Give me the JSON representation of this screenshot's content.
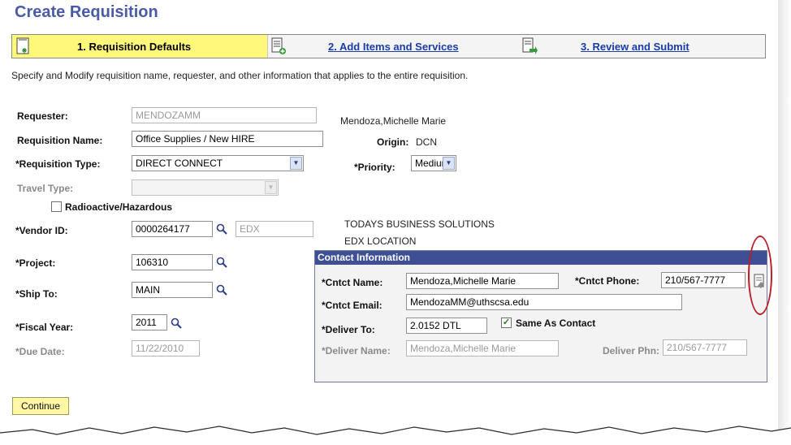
{
  "page_title": "Create Requisition",
  "steps": [
    {
      "label": "1. Requisition Defaults",
      "active": true
    },
    {
      "label": "2. Add Items and Services",
      "active": false
    },
    {
      "label": "3. Review and Submit",
      "active": false
    }
  ],
  "description": "Specify and Modify requisition name, requester, and other information that applies to the entire requisition.",
  "form": {
    "requester_label": "Requester:",
    "requester_value": "MENDOZAMM",
    "requester_name": "Mendoza,Michelle Marie",
    "req_name_label": "Requisition Name:",
    "req_name_value": "Office Supplies / New HIRE",
    "origin_label": "Origin:",
    "origin_value": "DCN",
    "req_type_label": "*Requisition Type:",
    "req_type_value": "DIRECT CONNECT",
    "priority_label": "*Priority:",
    "priority_value": "Medium",
    "travel_type_label": "Travel Type:",
    "travel_type_value": "",
    "radioactive_label": "Radioactive/Hazardous",
    "vendor_label": "*Vendor ID:",
    "vendor_value": "0000264177",
    "vendor_location": "EDX",
    "vendor_name": "TODAYS BUSINESS SOLUTIONS",
    "vendor_loc_name": "EDX LOCATION",
    "project_label": "*Project:",
    "project_value": "106310",
    "ship_to_label": "*Ship To:",
    "ship_to_value": "MAIN",
    "fiscal_year_label": "*Fiscal Year:",
    "fiscal_year_value": "2011",
    "due_date_label": "*Due Date:",
    "due_date_value": "11/22/2010"
  },
  "contact": {
    "header": "Contact Information",
    "name_label": "*Cntct Name:",
    "name_value": "Mendoza,Michelle Marie",
    "phone_label": "*Cntct Phone:",
    "phone_value": "210/567-7777",
    "email_label": "*Cntct Email:",
    "email_value": "MendozaMM@uthscsa.edu",
    "deliver_to_label": "*Deliver To:",
    "deliver_to_value": "2.0152 DTL",
    "same_as_contact_label": "Same As Contact",
    "deliver_name_label": "*Deliver Name:",
    "deliver_name_value": "Mendoza,Michelle Marie",
    "deliver_phone_label": "Deliver Phn:",
    "deliver_phone_value": "210/567-7777"
  },
  "continue_label": "Continue",
  "colors": {
    "title": "#4a5aa8",
    "active_step": "#fff87a",
    "link": "#1a3ca8",
    "contact_header": "#3e4f96",
    "highlight_oval": "#b8202a"
  },
  "icons": [
    "requisition-defaults-icon",
    "add-items-icon",
    "review-submit-icon",
    "magnifier-search-icon",
    "contact-details-icon"
  ]
}
